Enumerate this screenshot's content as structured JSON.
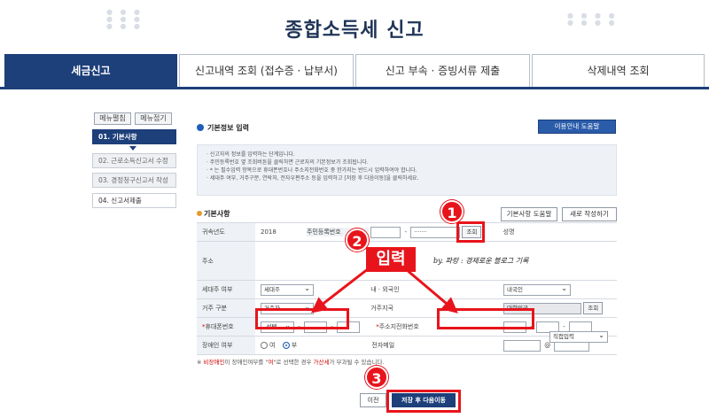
{
  "title": "종합소득세 신고",
  "tabs": [
    {
      "label": "세금신고",
      "active": true
    },
    {
      "label": "신고내역 조회 (접수증 · 납부서)",
      "active": false
    },
    {
      "label": "신고 부속 · 증빙서류 제출",
      "active": false
    },
    {
      "label": "삭제내역 조회",
      "active": false
    }
  ],
  "menu": {
    "expand_label": "메뉴펼침",
    "collapse_label": "메뉴접기",
    "items": [
      {
        "label": "01. 기본사항",
        "state": "active"
      },
      {
        "label": "02. 근로소득신고서 수정",
        "state": "disabled"
      },
      {
        "label": "03. 경정청구신고서 작성",
        "state": "disabled"
      },
      {
        "label": "04. 신고서제출",
        "state": "normal"
      }
    ]
  },
  "basic_input": {
    "title": "기본정보 입력",
    "guide_button": "이용안내 도움말",
    "notices": [
      "· 신고자의 정보를 입력하는 단계입니다.",
      "· 주민등록번호 옆 조회버튼을 클릭하면 근로자의 기본정보가 조회됩니다.",
      "· * 는 필수입력 항목으로 휴대폰번호나 주소지전화번호 중 한가지는 반드시 입력하여야 합니다.",
      "· 세대주 여부, 거주구분, 연락처, 전자우편주소 등을 입력하고 [저장 후 다음이동]을 클릭하세요."
    ]
  },
  "basic_section": {
    "title": "기본사항",
    "help_button": "기본사항 도움말",
    "new_button": "새로 작성하기"
  },
  "form": {
    "year_label": "귀속년도",
    "year_value": "2018",
    "rrn_label": "주민등록번호",
    "rrn_masked": "·······",
    "lookup_button": "조회",
    "name_label": "성명",
    "address_label": "주소",
    "household_label": "세대주 여부",
    "household_value": "세대주",
    "nationality_label": "내 · 외국인",
    "nationality_value": "내국인",
    "residence_label": "거주 구분",
    "residence_value": "거주자",
    "country_label": "거주지국",
    "country_value": "대한민국",
    "country_lookup": "조회",
    "mobile_label": "휴대폰번호",
    "mobile_select": "-선택-",
    "phone_label": "주소지전화번호",
    "disabled_label": "장애인 여부",
    "disabled_no": "여",
    "disabled_yes": "부",
    "email_label": "전자메일",
    "email_at": "@",
    "email_domain_select": "직접입력"
  },
  "warning": {
    "prefix": "※",
    "term1": "비장애인",
    "middle1": "이 장애인여부를 \"",
    "term2": "여",
    "middle2": "\"로 선택한 경우 ",
    "term3": "가산세",
    "suffix": "가 부과될 수 있습니다."
  },
  "buttons": {
    "prev": "이전",
    "next": "저장 후 다음이동"
  },
  "annotations": {
    "step1": "1",
    "step2": "2",
    "step3": "3",
    "input_label": "입력",
    "by_note": "by. 파랑 : 경제로운 블로그 기록"
  },
  "colors": {
    "accent_navy": "#1d3f7a",
    "annotation_red": "#e8141c",
    "button_blue": "#2a5caa"
  }
}
